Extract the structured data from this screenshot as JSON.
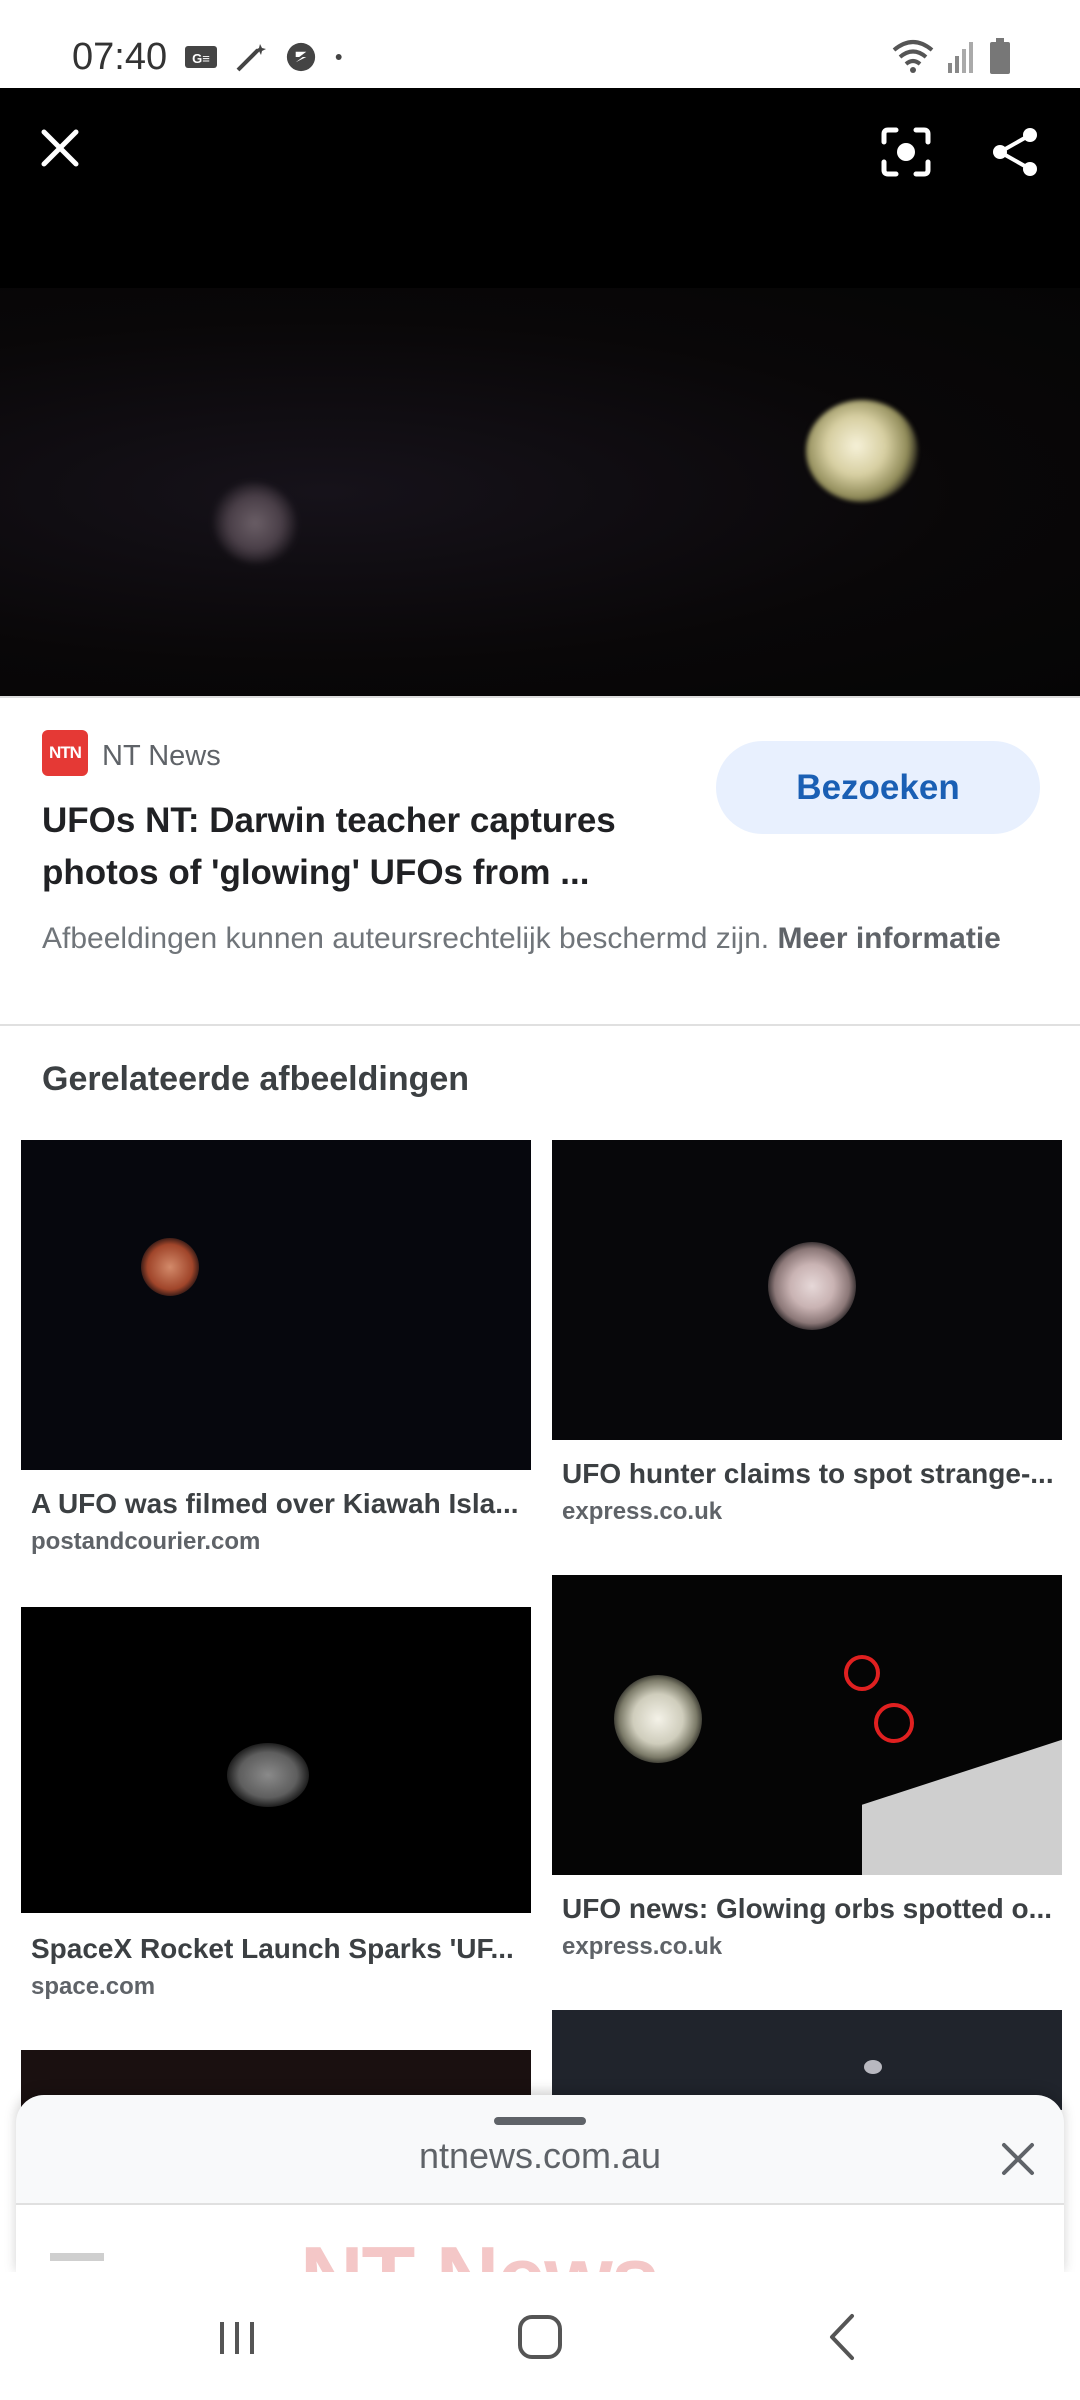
{
  "status_bar": {
    "time": "07:40",
    "left_icons": [
      "gmail-style-icon",
      "magic-wand-icon",
      "sync-icon",
      "dot-icon"
    ],
    "right_icons": [
      "wifi-icon",
      "signal-icon",
      "battery-icon"
    ]
  },
  "viewer": {
    "close_icon": "close-icon",
    "lens_icon": "lens-icon",
    "share_icon": "share-icon"
  },
  "source": {
    "logo_text": "NTN",
    "name": "NT News",
    "title": "UFOs NT: Darwin teacher captures photos of 'glowing' UFOs from ...",
    "visit_label": "Bezoeken",
    "copyright_text": "Afbeeldingen kunnen auteursrechtelijk beschermd zijn.",
    "copyright_link": "Meer informatie"
  },
  "related": {
    "heading": "Gerelateerde afbeeldingen",
    "items": [
      {
        "title": "A UFO was filmed over Kiawah Isla...",
        "site": "postandcourier.com"
      },
      {
        "title": "UFO hunter claims to spot strange-...",
        "site": "express.co.uk"
      },
      {
        "title": "SpaceX Rocket Launch Sparks 'UF...",
        "site": "space.com"
      },
      {
        "title": "UFO news: Glowing orbs spotted o...",
        "site": "express.co.uk"
      }
    ]
  },
  "sheet": {
    "url": "ntnews.com.au",
    "preview_logo": "NT News"
  },
  "nav_bar": {
    "buttons": [
      "recents-icon",
      "home-icon",
      "back-icon"
    ]
  },
  "colors": {
    "accent": "#1a5fb4",
    "button_bg": "#e8f0fe",
    "brand_red": "#e53935"
  }
}
